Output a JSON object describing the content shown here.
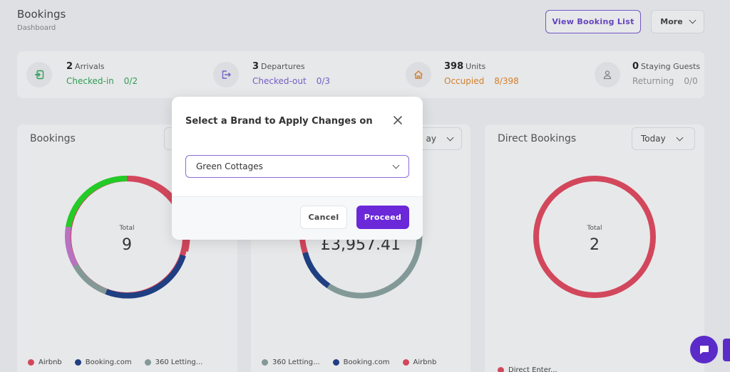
{
  "header": {
    "title": "Bookings",
    "subtitle": "Dashboard",
    "view_list_label": "View Booking List",
    "more_label": "More"
  },
  "stats": [
    {
      "count": "2",
      "label": "Arrivals",
      "sub_label": "Checked-in",
      "sub_value": "0/2",
      "color": "#2faa5a",
      "icon": "arrival-icon"
    },
    {
      "count": "3",
      "label": "Departures",
      "sub_label": "Checked-out",
      "sub_value": "0/3",
      "color": "#7e64d8",
      "icon": "departure-icon"
    },
    {
      "count": "398",
      "label": "Units",
      "sub_label": "Occupied",
      "sub_value": "8/398",
      "color": "#e8892c",
      "icon": "home-icon"
    },
    {
      "count": "0",
      "label": "Staying Guests",
      "sub_label": "Returning",
      "sub_value": "0/0",
      "color": "#9a9a9a",
      "icon": "user-icon"
    }
  ],
  "cards": {
    "bookings": {
      "title": "Bookings",
      "total_label": "Total",
      "total_value": "9",
      "legend": [
        {
          "name": "Airbnb",
          "color": "#e8485f"
        },
        {
          "name": "Booking.com",
          "color": "#1c3f8a"
        },
        {
          "name": "360 Letting...",
          "color": "#8ca5a3"
        }
      ]
    },
    "revenue": {
      "dropdown_label": "ay",
      "total_value": "£3,957.41",
      "legend": [
        {
          "name": "360 Letting...",
          "color": "#8ca5a3"
        },
        {
          "name": "Booking.com",
          "color": "#1c3f8a"
        },
        {
          "name": "Airbnb",
          "color": "#e8485f"
        }
      ]
    },
    "direct": {
      "title": "Direct Bookings",
      "dropdown_label": "Today",
      "total_label": "Total",
      "total_value": "2",
      "partial_legend": "Direct Enter..."
    }
  },
  "modal": {
    "title": "Select a Brand to Apply Changes on",
    "selected_brand": "Green Cottages",
    "cancel_label": "Cancel",
    "proceed_label": "Proceed"
  },
  "colors": {
    "accent": "#6a28d9",
    "green": "#22dd22",
    "red": "#e8485f",
    "navy": "#1c3f8a",
    "gray_green": "#8ca5a3",
    "violet": "#c979d2"
  }
}
